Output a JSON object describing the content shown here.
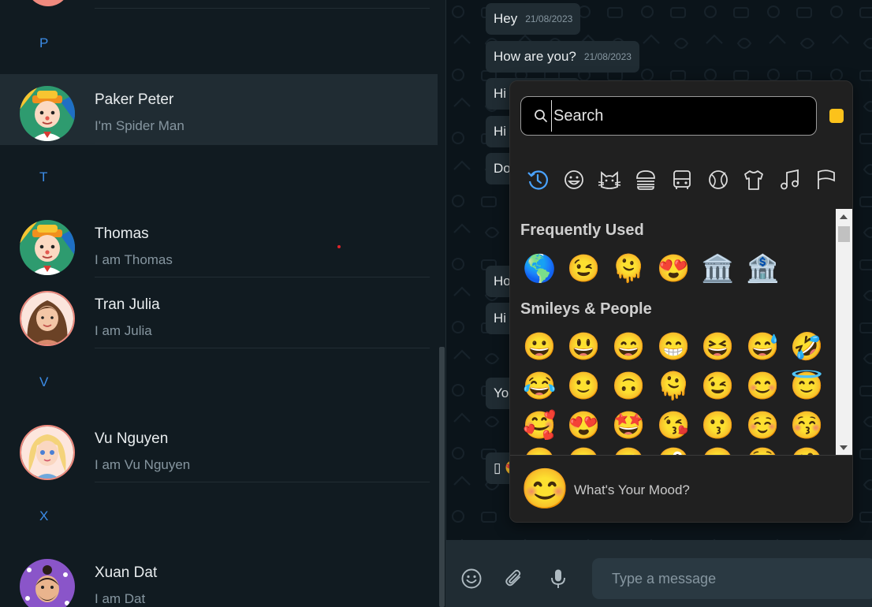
{
  "contacts_panel": {
    "sections": [
      {
        "letter": "P"
      },
      {
        "letter": "T"
      },
      {
        "letter": "V"
      },
      {
        "letter": "X"
      }
    ],
    "contacts": [
      {
        "name": "Paker Peter",
        "status": "I'm Spider Man",
        "active": true
      },
      {
        "name": "Thomas",
        "status": "I am Thomas",
        "active": false
      },
      {
        "name": "Tran Julia",
        "status": "I am Julia",
        "active": false
      },
      {
        "name": "Vu Nguyen",
        "status": "I am Vu Nguyen",
        "active": false
      },
      {
        "name": "Xuan Dat",
        "status": "I am Dat",
        "active": false
      }
    ]
  },
  "chat": {
    "messages": [
      {
        "text": "Hey",
        "time": "21/08/2023"
      },
      {
        "text": "How are you?",
        "time": "21/08/2023"
      },
      {
        "text": "Hi",
        "time": ""
      },
      {
        "text": "Hi",
        "time": ""
      },
      {
        "text": "Do",
        "time": ""
      },
      {
        "text": "Ho",
        "time": ""
      },
      {
        "text": "Hi",
        "time": ""
      },
      {
        "text": "You",
        "time": ""
      },
      {
        "text": "▯ 😍",
        "time": ""
      }
    ]
  },
  "emoji_picker": {
    "search_placeholder": "Search",
    "skin_tone_color": "#fcc21b",
    "categories": [
      "recent-icon",
      "smiley-icon",
      "animal-icon",
      "food-icon",
      "travel-icon",
      "activity-icon",
      "objects-icon",
      "symbols-icon",
      "flag-icon"
    ],
    "active_category": "recent-icon",
    "frequently_used_title": "Frequently Used",
    "frequently_used": [
      "🌎",
      "😉",
      "🫠",
      "😍",
      "🏛️",
      "🏦"
    ],
    "smileys_title": "Smileys & People",
    "smileys": [
      "😀",
      "😃",
      "😄",
      "😁",
      "😆",
      "😅",
      "🤣",
      "😂",
      "🙂",
      "🙃",
      "🫠",
      "😉",
      "😊",
      "😇",
      "🥰",
      "😍",
      "🤩",
      "😘",
      "😗",
      "☺️",
      "😚",
      "😋",
      "😛",
      "😜",
      "🤪",
      "😝",
      "🤑",
      "🤗"
    ],
    "mood_emoji": "😊",
    "mood_text": "What's Your Mood?"
  },
  "footer": {
    "message_placeholder": "Type a message",
    "icons": [
      "emoji-icon",
      "attach-icon",
      "mic-icon"
    ]
  },
  "colors": {
    "accent": "#3c8ce7",
    "panel_bg": "#111b21",
    "bubble_bg": "#202c33",
    "picker_bg": "#202020"
  }
}
